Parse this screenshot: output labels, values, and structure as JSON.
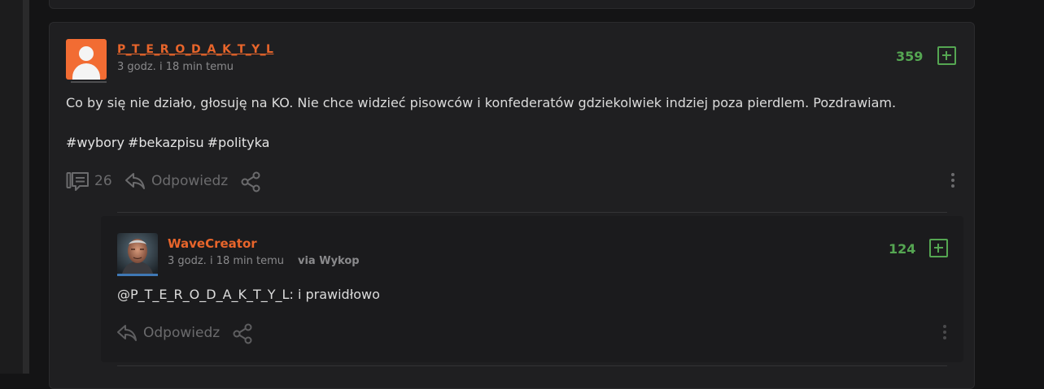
{
  "post": {
    "author": "P_T_E_R_O_D_A_K_T_Y_L",
    "time": "3 godz. i 18 min temu",
    "votes": "359",
    "content": "Co by się nie działo, głosuję na KO. Nie chce widzieć pisowców i konfederatów gdziekolwiek indziej poza pierdlem. Pozdrawiam.",
    "tags": [
      "#wybory",
      "#bekazpisu",
      "#polityka"
    ],
    "comment_count": "26",
    "reply_label": "Odpowiedz",
    "avatar_icon": "default-user-icon"
  },
  "reply": {
    "author": "WaveCreator",
    "time": "3 godz. i 18 min temu",
    "via": "via Wykop",
    "votes": "124",
    "content": "@P_T_E_R_O_D_A_K_T_Y_L: i prawidłowo",
    "reply_label": "Odpowiedz"
  },
  "colors": {
    "author": "#e8652b",
    "votes": "#55a652",
    "background": "#141415",
    "card": "#1f1f21"
  }
}
